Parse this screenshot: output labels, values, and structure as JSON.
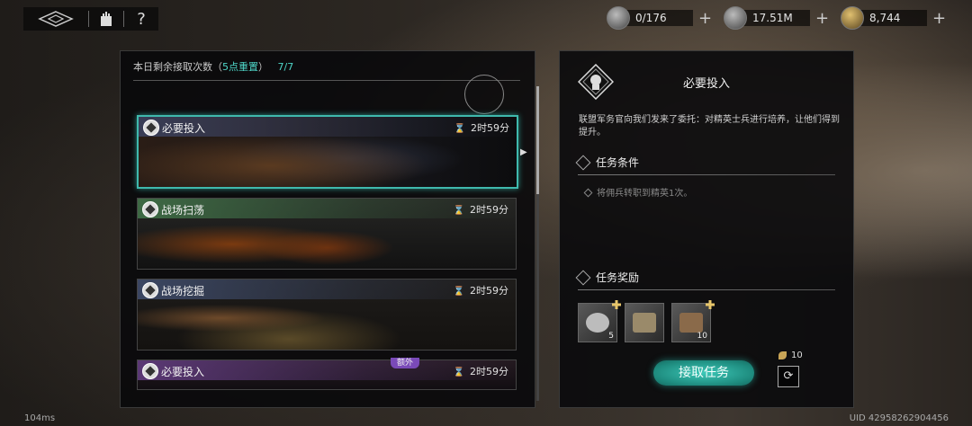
{
  "nav": {
    "help_label": "?"
  },
  "currencies": [
    {
      "icon": "stamina-icon",
      "value": "0/176"
    },
    {
      "icon": "silver-coin-icon",
      "value": "17.51M"
    },
    {
      "icon": "gold-icon",
      "value": "8,744"
    }
  ],
  "left_panel": {
    "header_prefix": "本日剩余接取次数（",
    "header_reset": "5点重置",
    "header_suffix": "）",
    "header_count": "7/7"
  },
  "quests": [
    {
      "name": "必要投入",
      "time": "2时59分",
      "band_color": "#3a3f5a"
    },
    {
      "name": "战场扫荡",
      "time": "2时59分",
      "band_color": "#3f6d46"
    },
    {
      "name": "战场挖掘",
      "time": "2时59分",
      "band_color": "#3d4966"
    },
    {
      "name": "必要投入",
      "time": "2时59分",
      "band_color": "#5e3a7a"
    }
  ],
  "extra_badge": "额外",
  "detail": {
    "title": "必要投入",
    "description": "联盟军务官向我们发来了委托：对精英士兵进行培养，让他们得到提升。",
    "conditions_title": "任务条件",
    "condition_1": "将佣兵转职到精英1次。",
    "rewards_title": "任务奖励",
    "rewards": [
      {
        "icon": "mercenary-token-icon",
        "count": "5"
      },
      {
        "icon": "chest-icon",
        "count": ""
      },
      {
        "icon": "chest-icon",
        "count": "10"
      }
    ],
    "accept_label": "接取任务",
    "cost": "10"
  },
  "footer": {
    "ping": "104ms",
    "uid": "UID 42958262904456"
  },
  "colors": {
    "accent": "#3fb9ad",
    "highlight": "#4fd6c8"
  }
}
